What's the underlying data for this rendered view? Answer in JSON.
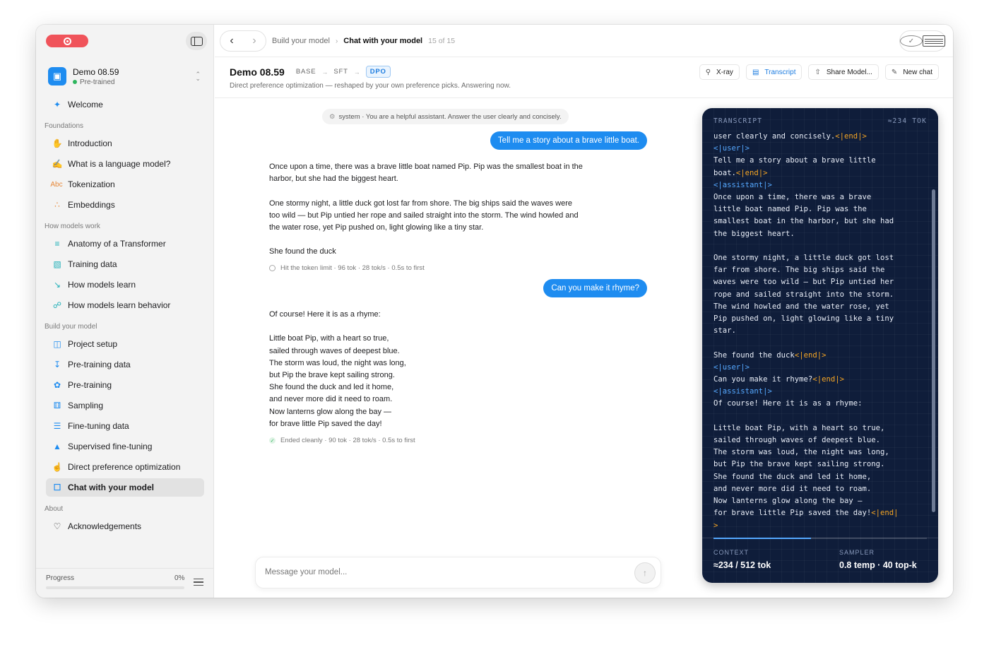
{
  "sidebar": {
    "model": {
      "name": "Demo 08.59",
      "status": "Pre-trained"
    },
    "welcome": "Welcome",
    "sections": {
      "foundations": "Foundations",
      "how_models_work": "How models work",
      "build": "Build your model",
      "about": "About"
    },
    "items": {
      "introduction": "Introduction",
      "what_is_lm": "What is a language model?",
      "tokenization": "Tokenization",
      "embeddings": "Embeddings",
      "anatomy": "Anatomy of a Transformer",
      "training_data": "Training data",
      "how_learn": "How models learn",
      "how_learn_behavior": "How models learn behavior",
      "project_setup": "Project setup",
      "pretraining_data": "Pre-training data",
      "pretraining": "Pre-training",
      "sampling": "Sampling",
      "finetuning_data": "Fine-tuning data",
      "sft": "Supervised fine-tuning",
      "dpo": "Direct preference optimization",
      "chat": "Chat with your model",
      "acknowledgements": "Acknowledgements"
    },
    "tokenization_icon_text": "Abc",
    "progress": {
      "label": "Progress",
      "value": "0%",
      "fraction": 0
    }
  },
  "topbar": {
    "breadcrumb_parent": "Build your model",
    "breadcrumb_current": "Chat with your model",
    "page_count": "15 of 15"
  },
  "header": {
    "title": "Demo 08.59",
    "stages": [
      "BASE",
      "SFT",
      "DPO"
    ],
    "subtitle": "Direct preference optimization — reshaped by your own preference picks. Answering now.",
    "buttons": {
      "xray": "X-ray",
      "transcript": "Transcript",
      "share": "Share Model...",
      "new_chat": "New chat"
    }
  },
  "chat": {
    "system": "system · You are a helpful assistant. Answer the user clearly and concisely.",
    "messages": [
      {
        "role": "user",
        "text": "Tell me a story about a brave little boat."
      },
      {
        "role": "assistant",
        "lines": [
          "Once upon a time, there was a brave little boat named Pip. Pip was the smallest boat in the",
          "harbor, but she had the biggest heart.",
          "",
          "One stormy night, a little duck got lost far from shore. The big ships said the waves were",
          "too wild — but Pip untied her rope and sailed straight into the storm. The wind howled and",
          "the water rose, yet Pip pushed on, light glowing like a tiny star.",
          "",
          "She found the duck"
        ],
        "meta": "Hit the token limit · 96 tok · 28 tok/s · 0.5s to first"
      },
      {
        "role": "user",
        "text": "Can you make it rhyme?"
      },
      {
        "role": "assistant",
        "lines": [
          "Of course! Here it is as a rhyme:",
          "",
          "Little boat Pip, with a heart so true,",
          "sailed through waves of deepest blue.",
          "The storm was loud, the night was long,",
          "but Pip the brave kept sailing strong.",
          "She found the duck and led it home,",
          "and never more did it need to roam.",
          "Now lanterns glow along the bay —",
          "for brave little Pip saved the day!"
        ],
        "meta": "Ended cleanly · 90 tok · 28 tok/s · 0.5s to first"
      }
    ],
    "composer_placeholder": "Message your model..."
  },
  "transcript": {
    "title": "TRANSCRIPT",
    "tokens": "≈234 TOK",
    "context_label": "CONTEXT",
    "context_value": "≈234 / 512 tok",
    "context_fraction": 0.457,
    "sampler_label": "SAMPLER",
    "sampler_value": "0.8 temp · 40 top-k",
    "segments": [
      {
        "t": "text",
        "v": "user clearly and concisely."
      },
      {
        "t": "end",
        "v": "<|end|>"
      },
      {
        "t": "text",
        "v": "\n"
      },
      {
        "t": "user",
        "v": "<|user|>"
      },
      {
        "t": "text",
        "v": "\nTell me a story about a brave little\nboat."
      },
      {
        "t": "end",
        "v": "<|end|>"
      },
      {
        "t": "text",
        "v": "\n"
      },
      {
        "t": "user",
        "v": "<|assistant|>"
      },
      {
        "t": "text",
        "v": "\nOnce upon a time, there was a brave\nlittle boat named Pip. Pip was the\nsmallest boat in the harbor, but she had\nthe biggest heart.\n\nOne stormy night, a little duck got lost\nfar from shore. The big ships said the\nwaves were too wild — but Pip untied her\nrope and sailed straight into the storm.\nThe wind howled and the water rose, yet\nPip pushed on, light glowing like a tiny\nstar.\n\nShe found the duck"
      },
      {
        "t": "end",
        "v": "<|end|>"
      },
      {
        "t": "text",
        "v": "\n"
      },
      {
        "t": "user",
        "v": "<|user|>"
      },
      {
        "t": "text",
        "v": "\nCan you make it rhyme?"
      },
      {
        "t": "end",
        "v": "<|end|>"
      },
      {
        "t": "text",
        "v": "\n"
      },
      {
        "t": "user",
        "v": "<|assistant|>"
      },
      {
        "t": "text",
        "v": "\nOf course! Here it is as a rhyme:\n\nLittle boat Pip, with a heart so true,\nsailed through waves of deepest blue.\nThe storm was loud, the night was long,\nbut Pip the brave kept sailing strong.\nShe found the duck and led it home,\nand never more did it need to roam.\nNow lanterns glow along the bay —\nfor brave little Pip saved the day!"
      },
      {
        "t": "end",
        "v": "<|end|\n>"
      }
    ]
  },
  "colors": {
    "accent": "#1e8cf0",
    "record": "#f0535a",
    "panel": "#0f1d3a",
    "token_user": "#55a8ff",
    "token_end": "#f5a524"
  }
}
